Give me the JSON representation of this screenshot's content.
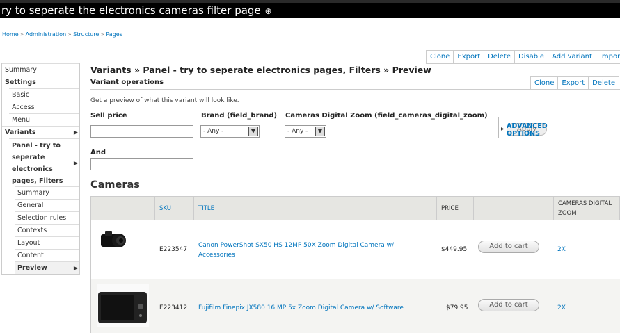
{
  "window": {
    "title": "ry to seperate the electronics cameras filter page",
    "title_icon": "⊕"
  },
  "breadcrumb": [
    "Home",
    "Administration",
    "Structure",
    "Pages"
  ],
  "top_actions": [
    "Clone",
    "Export",
    "Delete",
    "Disable",
    "Add variant",
    "Import v"
  ],
  "sidebar": {
    "summary": "Summary",
    "settings": "Settings",
    "basic": "Basic",
    "access": "Access",
    "menu": "Menu",
    "variants": "Variants",
    "variant_name": "Panel - try to seperate electronics pages, Filters",
    "sub": [
      "Summary",
      "General",
      "Selection rules",
      "Contexts",
      "Layout",
      "Content",
      "Preview"
    ],
    "arrow": "▶"
  },
  "main": {
    "heading": "Variants » Panel - try to seperate electronics pages, Filters » Preview",
    "variant_operations": "Variant operations",
    "variant_actions": [
      "Clone",
      "Export",
      "Delete"
    ],
    "description": "Get a preview of what this variant will look like."
  },
  "filters": {
    "sell_price_label": "Sell price",
    "brand_label": "Brand (field_brand)",
    "brand_value": "- Any -",
    "zoom_label": "Cameras Digital Zoom (field_cameras_digital_zoom)",
    "zoom_value": "- Any -",
    "and_label": "And",
    "apply": "Apply",
    "advanced_1": "ADVANCED",
    "advanced_2": "OPTIONS"
  },
  "cameras": {
    "title": "Cameras",
    "headers": {
      "sku": "SKU",
      "title": "TITLE",
      "price": "PRICE",
      "zoom_1": "CAMERAS DIGITAL",
      "zoom_2": "ZOOM"
    },
    "rows": [
      {
        "sku": "E223547",
        "title_1": "Canon PowerShot SX50 HS 12MP 50X Zoom Digital Camera w/",
        "title_2": "Accessories",
        "price": "$449.95",
        "cart": "Add to cart",
        "zoom": "2X"
      },
      {
        "sku": "E223412",
        "title_1": "Fujifilm Finepix JX580 16 MP 5x Zoom Digital Camera w/ Software",
        "title_2": "",
        "price": "$79.95",
        "cart": "Add to cart",
        "zoom": "2X"
      }
    ]
  }
}
